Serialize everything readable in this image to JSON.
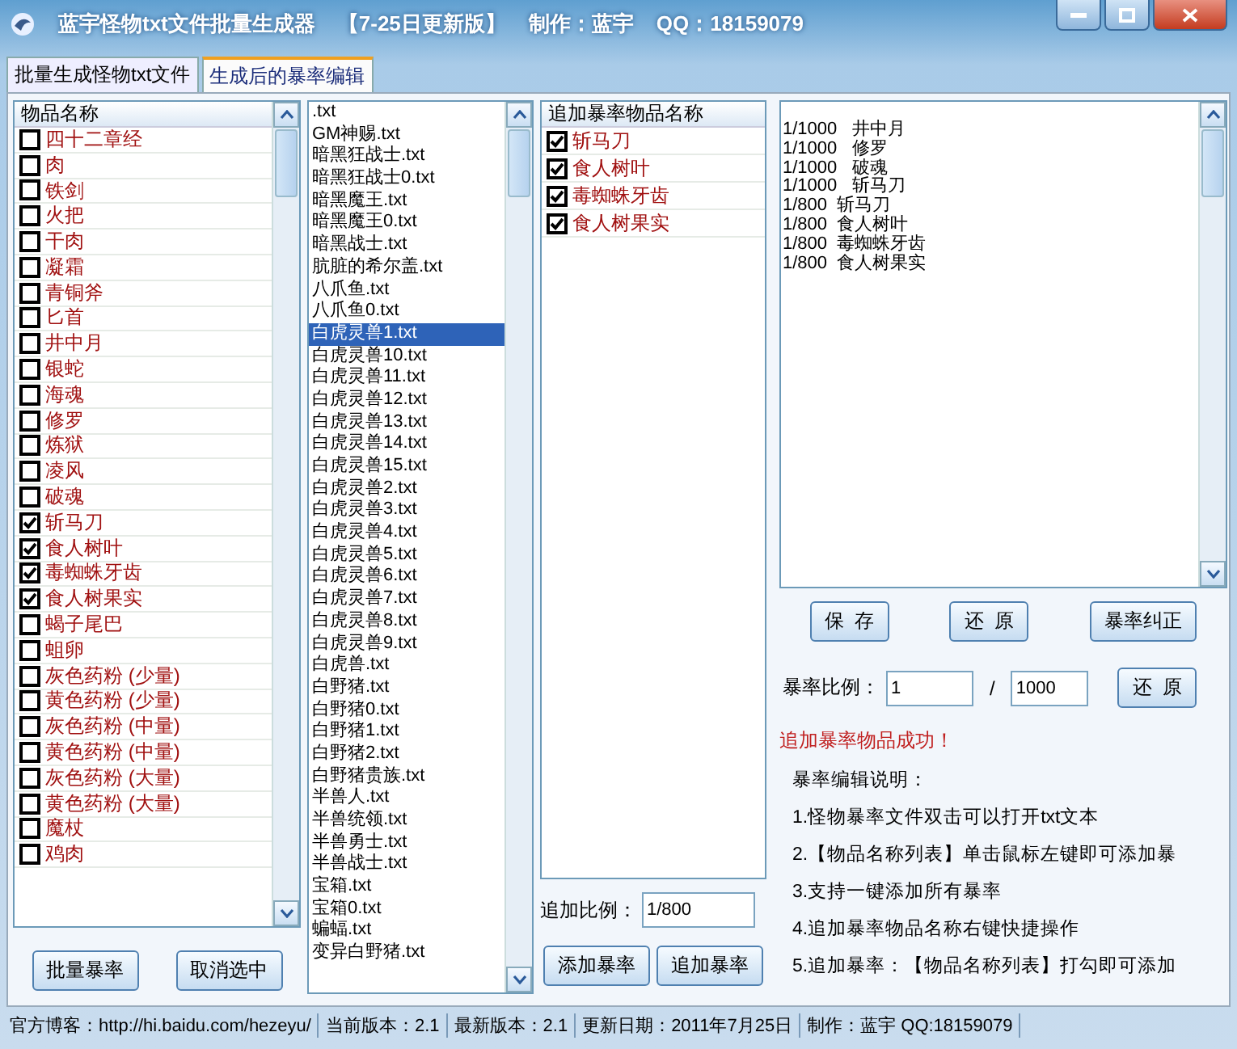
{
  "window": {
    "title": "蓝宇怪物txt文件批量生成器",
    "edition": "【7-25日更新版】",
    "author": "制作：蓝宇",
    "qq": "QQ：18159079"
  },
  "tabs": [
    {
      "label": "批量生成怪物txt文件",
      "selected": false
    },
    {
      "label": "生成后的暴率编辑",
      "selected": true
    }
  ],
  "item_list": {
    "header": "物品名称",
    "items": [
      {
        "name": "四十二章经",
        "checked": false
      },
      {
        "name": "肉",
        "checked": false
      },
      {
        "name": "铁剑",
        "checked": false
      },
      {
        "name": "火把",
        "checked": false
      },
      {
        "name": "干肉",
        "checked": false
      },
      {
        "name": "凝霜",
        "checked": false
      },
      {
        "name": "青铜斧",
        "checked": false
      },
      {
        "name": "匕首",
        "checked": false
      },
      {
        "name": "井中月",
        "checked": false
      },
      {
        "name": "银蛇",
        "checked": false
      },
      {
        "name": "海魂",
        "checked": false
      },
      {
        "name": "修罗",
        "checked": false
      },
      {
        "name": "炼狱",
        "checked": false
      },
      {
        "name": "凌风",
        "checked": false
      },
      {
        "name": "破魂",
        "checked": false
      },
      {
        "name": "斩马刀",
        "checked": true
      },
      {
        "name": "食人树叶",
        "checked": true
      },
      {
        "name": "毒蜘蛛牙齿",
        "checked": true
      },
      {
        "name": "食人树果实",
        "checked": true
      },
      {
        "name": "蝎子尾巴",
        "checked": false
      },
      {
        "name": "蛆卵",
        "checked": false
      },
      {
        "name": "灰色药粉 (少量)",
        "checked": false
      },
      {
        "name": "黄色药粉 (少量)",
        "checked": false
      },
      {
        "name": "灰色药粉 (中量)",
        "checked": false
      },
      {
        "name": "黄色药粉 (中量)",
        "checked": false
      },
      {
        "name": "灰色药粉 (大量)",
        "checked": false
      },
      {
        "name": "黄色药粉 (大量)",
        "checked": false
      },
      {
        "name": "魔杖",
        "checked": false
      },
      {
        "name": "鸡肉",
        "checked": false
      }
    ]
  },
  "item_buttons": [
    "批量暴率",
    "取消选中"
  ],
  "file_list": {
    "items": [
      {
        "name": ".txt",
        "selected": false
      },
      {
        "name": "GM神赐.txt",
        "selected": false
      },
      {
        "name": "暗黑狂战士.txt",
        "selected": false
      },
      {
        "name": "暗黑狂战士0.txt",
        "selected": false
      },
      {
        "name": "暗黑魔王.txt",
        "selected": false
      },
      {
        "name": "暗黑魔王0.txt",
        "selected": false
      },
      {
        "name": "暗黑战士.txt",
        "selected": false
      },
      {
        "name": "肮脏的希尔盖.txt",
        "selected": false
      },
      {
        "name": "八爪鱼.txt",
        "selected": false
      },
      {
        "name": "八爪鱼0.txt",
        "selected": false
      },
      {
        "name": "白虎灵兽1.txt",
        "selected": true
      },
      {
        "name": "白虎灵兽10.txt",
        "selected": false
      },
      {
        "name": "白虎灵兽11.txt",
        "selected": false
      },
      {
        "name": "白虎灵兽12.txt",
        "selected": false
      },
      {
        "name": "白虎灵兽13.txt",
        "selected": false
      },
      {
        "name": "白虎灵兽14.txt",
        "selected": false
      },
      {
        "name": "白虎灵兽15.txt",
        "selected": false
      },
      {
        "name": "白虎灵兽2.txt",
        "selected": false
      },
      {
        "name": "白虎灵兽3.txt",
        "selected": false
      },
      {
        "name": "白虎灵兽4.txt",
        "selected": false
      },
      {
        "name": "白虎灵兽5.txt",
        "selected": false
      },
      {
        "name": "白虎灵兽6.txt",
        "selected": false
      },
      {
        "name": "白虎灵兽7.txt",
        "selected": false
      },
      {
        "name": "白虎灵兽8.txt",
        "selected": false
      },
      {
        "name": "白虎灵兽9.txt",
        "selected": false
      },
      {
        "name": "白虎兽.txt",
        "selected": false
      },
      {
        "name": "白野猪.txt",
        "selected": false
      },
      {
        "name": "白野猪0.txt",
        "selected": false
      },
      {
        "name": "白野猪1.txt",
        "selected": false
      },
      {
        "name": "白野猪2.txt",
        "selected": false
      },
      {
        "name": "白野猪贵族.txt",
        "selected": false
      },
      {
        "name": "半兽人.txt",
        "selected": false
      },
      {
        "name": "半兽统领.txt",
        "selected": false
      },
      {
        "name": "半兽勇士.txt",
        "selected": false
      },
      {
        "name": "半兽战士.txt",
        "selected": false
      },
      {
        "name": "宝箱.txt",
        "selected": false
      },
      {
        "name": "宝箱0.txt",
        "selected": false
      },
      {
        "name": "蝙蝠.txt",
        "selected": false
      },
      {
        "name": "变异白野猪.txt",
        "selected": false
      }
    ]
  },
  "drop_list": {
    "header": "追加暴率物品名称",
    "items": [
      {
        "name": "斩马刀",
        "checked": true
      },
      {
        "name": "食人树叶",
        "checked": true
      },
      {
        "name": "毒蜘蛛牙齿",
        "checked": true
      },
      {
        "name": "食人树果实",
        "checked": true
      }
    ]
  },
  "add_ratio": {
    "label": "追加比例：",
    "value": "1/800"
  },
  "drop_buttons": [
    "添加暴率",
    "追加暴率"
  ],
  "drop_text": [
    "1/1000   井中月",
    "1/1000   修罗",
    "1/1000   破魂",
    "1/1000   斩马刀",
    "1/800  斩马刀",
    "1/800  食人树叶",
    "1/800  毒蜘蛛牙齿",
    "1/800  食人树果实"
  ],
  "editor_buttons": [
    "保  存",
    "还  原",
    "暴率纠正"
  ],
  "ratio": {
    "label": "暴率比例：",
    "numerator": "1",
    "separator": "/",
    "denominator": "1000",
    "button": "还  原"
  },
  "message": "追加暴率物品成功！",
  "help": {
    "title": "暴率编辑说明：",
    "lines": [
      "1.怪物暴率文件双击可以打开txt文本",
      "2.【物品名称列表】单击鼠标左键即可添加暴",
      "3.支持一键添加所有暴率",
      "4.追加暴率物品名称右键快捷操作",
      "5.追加暴率：【物品名称列表】打勾即可添加"
    ]
  },
  "status_bar": [
    "官方博客：http://hi.baidu.com/hezeyu/",
    "当前版本：2.1",
    "最新版本：2.1",
    "更新日期：2011年7月25日",
    "制作：蓝宇 QQ:18159079"
  ]
}
